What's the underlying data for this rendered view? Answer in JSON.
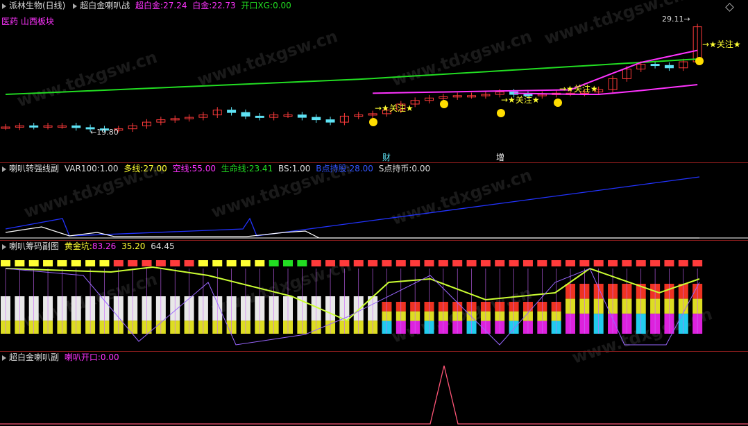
{
  "main": {
    "stock_name": "派林生物(日线)",
    "indicator_name": "超白金喇叭战",
    "label_super_platinum": "超白金:",
    "value_super_platinum": "27.24",
    "label_platinum": "白金:",
    "value_platinum": "22.73",
    "label_open": "开口XG:",
    "value_open": "0.00",
    "sector": "医药 山西板块",
    "high_label": "29.11",
    "low_label": "19.80",
    "attention_text": "→★关注★",
    "marker_cai": "财",
    "marker_zeng": "增"
  },
  "pane2": {
    "title": "喇叭转强线副",
    "var_label": "VAR100:",
    "var_value": "1.00",
    "bull_label": "多线:",
    "bull_value": "27.00",
    "bear_label": "空线:",
    "bear_value": "55.00",
    "life_label": "生命线:",
    "life_value": "23.41",
    "bs_label": "BS:",
    "bs_value": "1.00",
    "b_label": "B点持股:",
    "b_value": "28.00",
    "s_label": "S点持币:",
    "s_value": "0.00"
  },
  "pane3": {
    "title": "喇叭筹码副图",
    "gold_label": "黄金坑:",
    "v1": "83.26",
    "v2": "35.20",
    "v3": "64.45"
  },
  "pane4": {
    "title": "超白金喇叭副",
    "open_label": "喇叭开口:",
    "open_value": "0.00"
  },
  "watermark": "www.tdxgsw.cn",
  "colors": {
    "up": "#ff3b3b",
    "down": "#5fe3f5",
    "green_line": "#22dd22",
    "magenta_line": "#ff33ff",
    "yellow": "#ffff33",
    "grid": "#8a1c1c"
  }
}
